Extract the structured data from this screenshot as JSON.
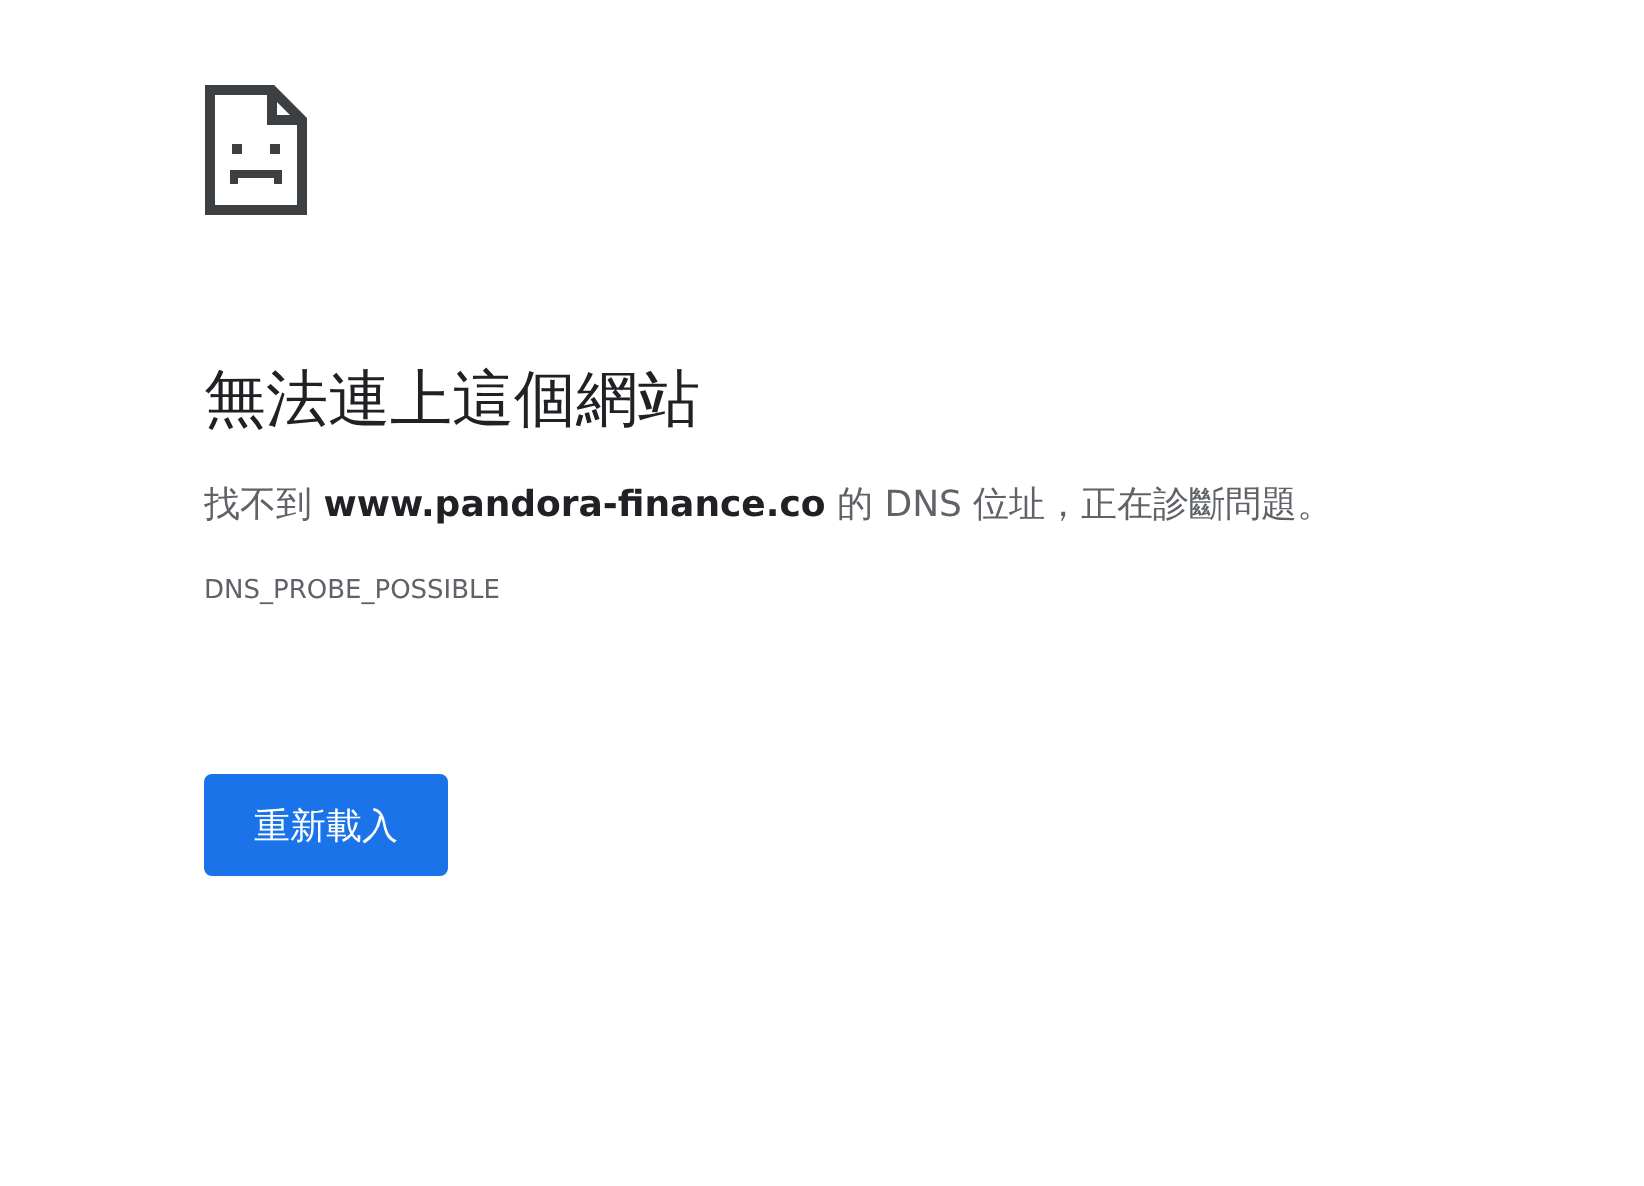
{
  "heading": "無法連上這個網站",
  "message": "找不到 **www.pandora-finance.co** 的 DNS 位址，正在診斷問題。",
  "error_code": "DNS_PROBE_POSSIBLE",
  "buttons": [
    {
      "label": "重新載入",
      "kind": "primary"
    }
  ]
}
